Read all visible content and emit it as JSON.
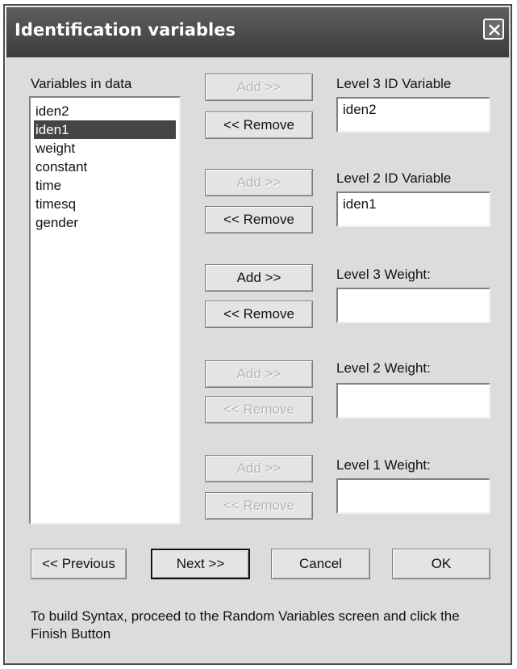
{
  "dialog": {
    "title": "Identification variables"
  },
  "variables": {
    "label": "Variables in data",
    "items": [
      "iden2",
      "iden1",
      "weight",
      "constant",
      "time",
      "timesq",
      "gender"
    ],
    "selected_index": 1
  },
  "rows": [
    {
      "add_label": "Add >>",
      "remove_label": "<< Remove",
      "field_label": "Level 3 ID Variable",
      "field_value": "iden2"
    },
    {
      "add_label": "Add >>",
      "remove_label": "<< Remove",
      "field_label": "Level 2 ID Variable",
      "field_value": "iden1"
    },
    {
      "add_label": "Add >>",
      "remove_label": "<< Remove",
      "field_label": "Level 3 Weight:",
      "field_value": ""
    },
    {
      "add_label": "Add >>",
      "remove_label": "<< Remove",
      "field_label": "Level 2 Weight:",
      "field_value": ""
    },
    {
      "add_label": "Add >>",
      "remove_label": "<< Remove",
      "field_label": "Level 1 Weight:",
      "field_value": ""
    }
  ],
  "nav": {
    "previous": "<< Previous",
    "next": "Next >>",
    "cancel": "Cancel",
    "ok": "OK"
  },
  "footer_text": "To build  Syntax, proceed to the Random Variables screen and click the Finish Button",
  "colors": {
    "titlebar": "#4a4a4a",
    "selection": "#454545",
    "dialog_bg": "#dcdcdc"
  }
}
